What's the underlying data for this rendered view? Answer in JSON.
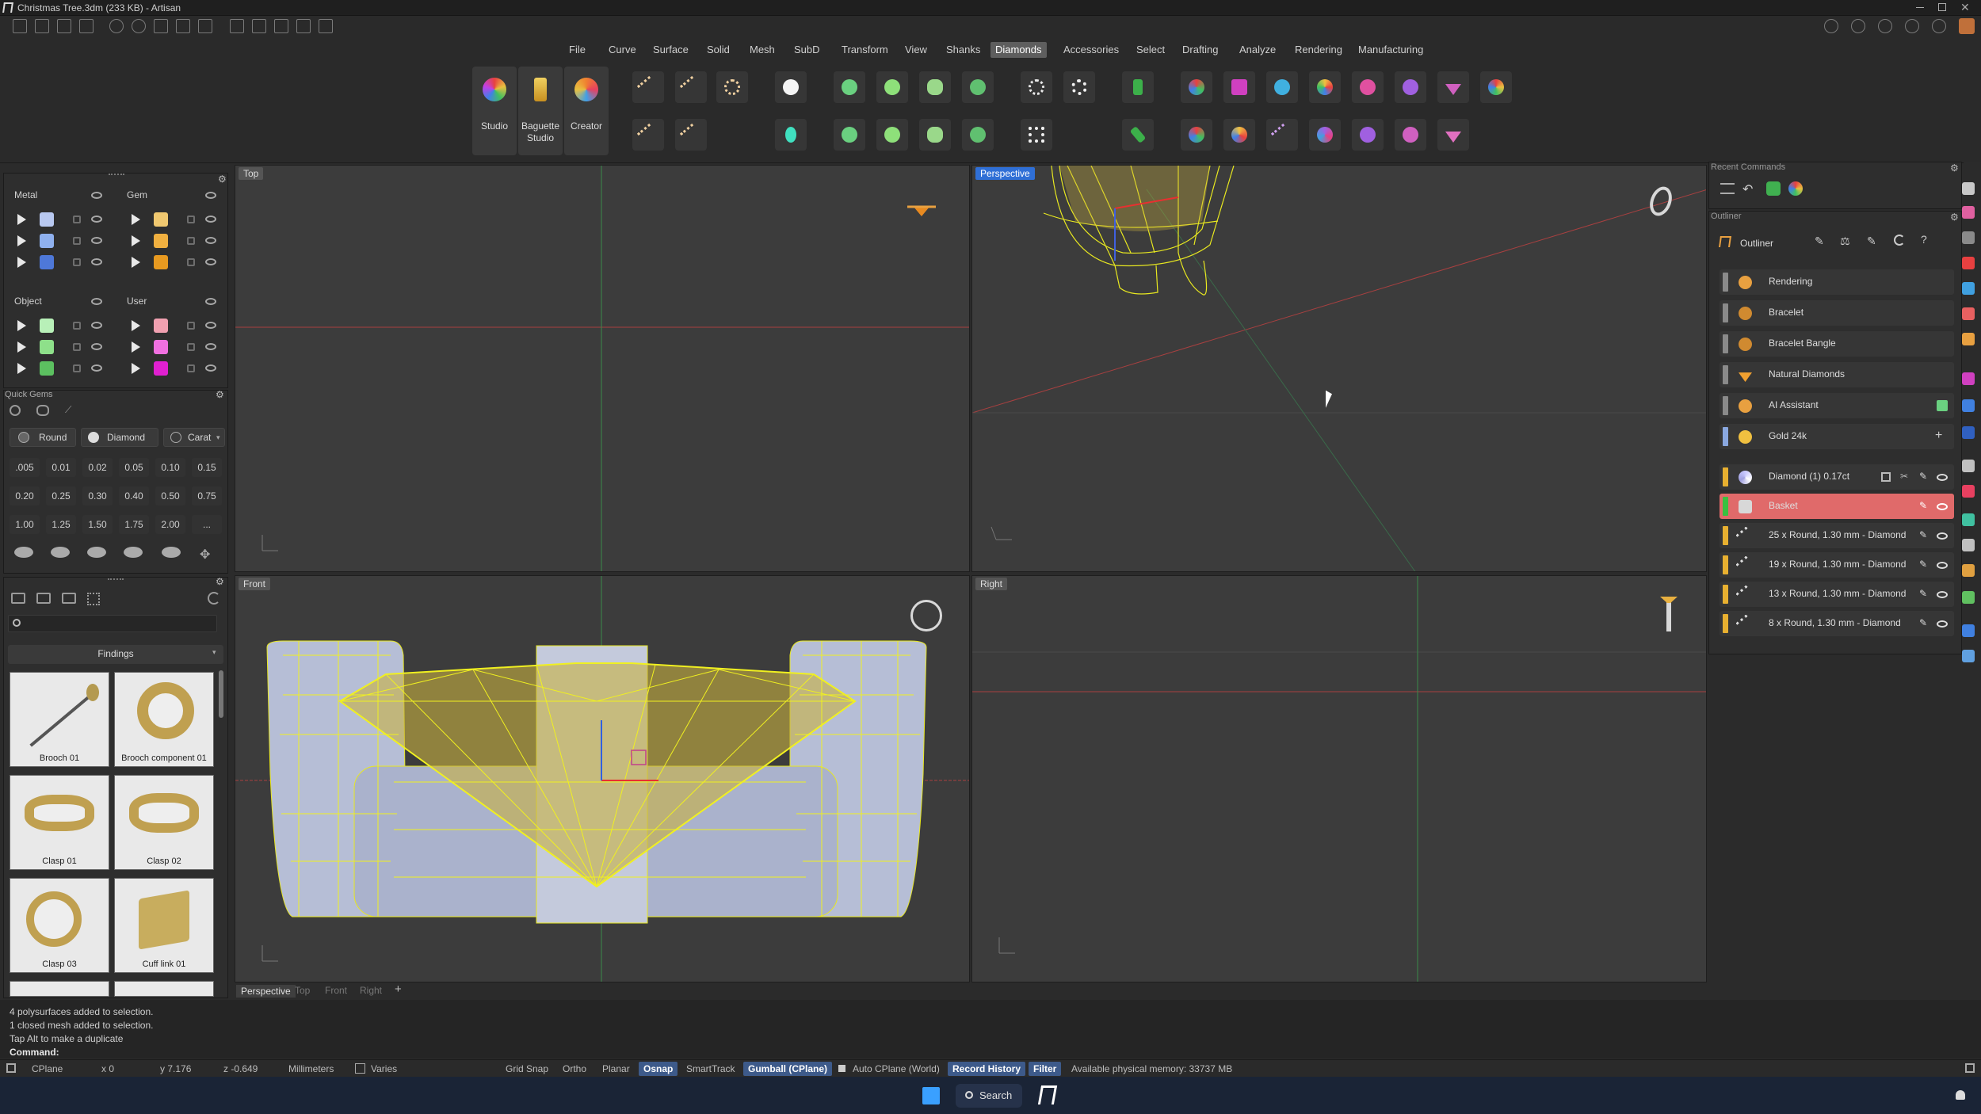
{
  "window": {
    "title": "Christmas Tree.3dm (233 KB) - Artisan"
  },
  "menu": [
    "File",
    "Curve",
    "Surface",
    "Solid",
    "Mesh",
    "SubD",
    "Transform",
    "View",
    "Shanks",
    "Diamonds",
    "Accessories",
    "Select",
    "Drafting",
    "Analyze",
    "Rendering",
    "Manufacturing"
  ],
  "menu_active": "Diamonds",
  "toolbar": {
    "studio": "Studio",
    "baguette": "Baguette Studio",
    "creator": "Creator"
  },
  "layers": {
    "metal": "Metal",
    "gem": "Gem",
    "object": "Object",
    "user": "User"
  },
  "quick_gems": {
    "title": "Quick Gems",
    "shape": "Round",
    "material": "Diamond",
    "unit": "Carat",
    "values": [
      ".005",
      "0.01",
      "0.02",
      "0.05",
      "0.10",
      "0.15",
      "0.20",
      "0.25",
      "0.30",
      "0.40",
      "0.50",
      "0.75",
      "1.00",
      "1.25",
      "1.50",
      "1.75",
      "2.00",
      "..."
    ]
  },
  "findings": {
    "title": "Findings",
    "items": [
      "Brooch 01",
      "Brooch component 01",
      "Clasp 01",
      "Clasp 02",
      "Clasp 03",
      "Cuff link 01"
    ]
  },
  "viewports": {
    "top": "Top",
    "perspective": "Perspective",
    "front": "Front",
    "right": "Right"
  },
  "viewport_tabs": [
    "Perspective",
    "Top",
    "Front",
    "Right",
    "+"
  ],
  "recent_commands": "Recent Commands",
  "outliner": {
    "panel_title": "Outliner",
    "title": "Outliner",
    "items": [
      {
        "label": "Rendering",
        "bar": "#8a8a8a",
        "icon": "#e8a040"
      },
      {
        "label": "Bracelet",
        "bar": "#8a8a8a",
        "icon": "#d08a30"
      },
      {
        "label": "Bracelet Bangle",
        "bar": "#8a8a8a",
        "icon": "#d08a30"
      },
      {
        "label": "Natural Diamonds",
        "bar": "#8a8a8a",
        "icon": "#f0a030"
      },
      {
        "label": "AI Assistant",
        "bar": "#8a8a8a",
        "icon": "#e8a040"
      },
      {
        "label": "Gold 24k",
        "bar": "#8aa8e0",
        "icon": "#f0c040"
      }
    ],
    "objects": [
      {
        "label": "Diamond (1) 0.17ct",
        "bar": "#e8b030",
        "icon": "#c8c8ff"
      },
      {
        "label": "Basket",
        "bar": "#3ac040",
        "icon": "#d8d8d8"
      },
      {
        "label": "25 x Round, 1.30 mm - Diamond",
        "bar": "#e8b030",
        "icon": "#d8d8d8"
      },
      {
        "label": "19 x Round, 1.30 mm - Diamond",
        "bar": "#e8b030",
        "icon": "#d8d8d8"
      },
      {
        "label": "13 x Round, 1.30 mm - Diamond",
        "bar": "#e8b030",
        "icon": "#d8d8d8"
      },
      {
        "label": "8 x Round, 1.30 mm - Diamond",
        "bar": "#e8b030",
        "icon": "#d8d8d8"
      }
    ]
  },
  "command_history": [
    "4 polysurfaces added to selection.",
    "1 closed mesh added to selection.",
    "Tap Alt to make a duplicate"
  ],
  "command_label": "Command:",
  "status": {
    "cplane": "CPlane",
    "x": "x 0",
    "y": "y 7.176",
    "z": "z -0.649",
    "units": "Millimeters",
    "varies": "Varies",
    "grid_snap": "Grid Snap",
    "ortho": "Ortho",
    "planar": "Planar",
    "osnap": "Osnap",
    "smarttrack": "SmartTrack",
    "gumball": "Gumball (CPlane)",
    "auto_cplane": "Auto CPlane (World)",
    "record_history": "Record History",
    "filter": "Filter",
    "memory": "Available physical memory: 33737 MB"
  },
  "taskbar": {
    "search": "Search"
  }
}
